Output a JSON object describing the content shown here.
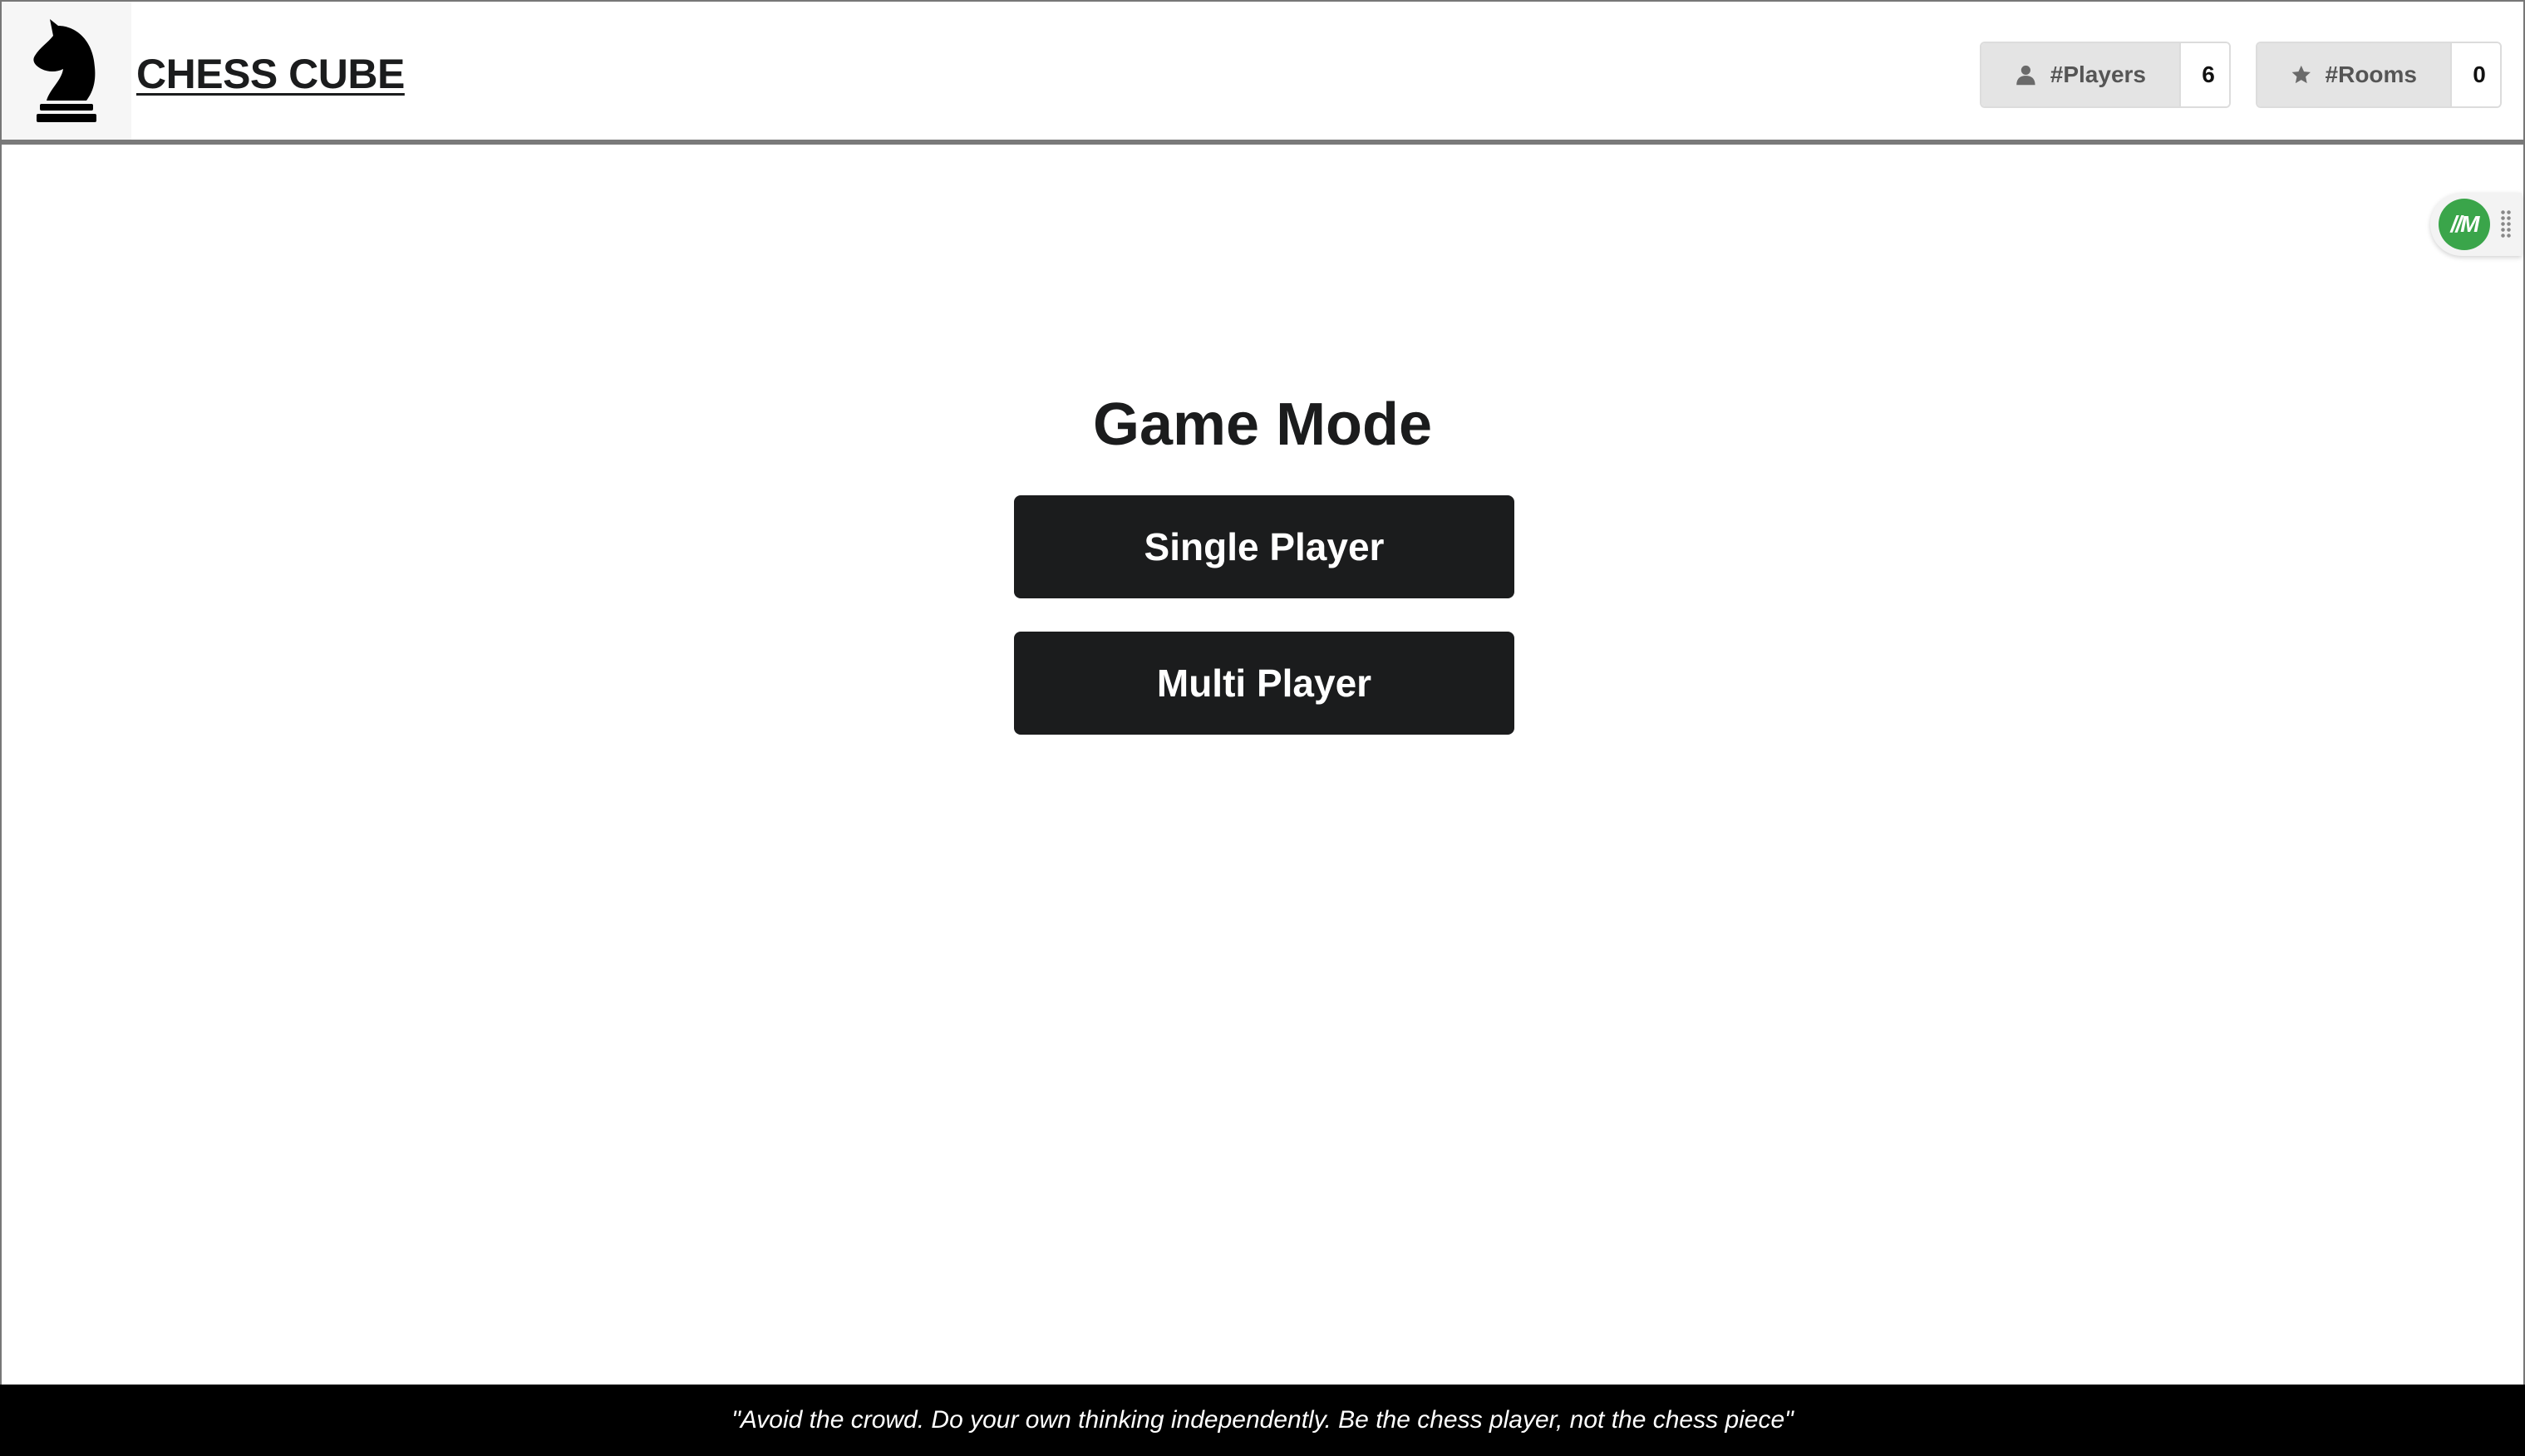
{
  "header": {
    "logo_icon": "chess-knight-icon",
    "brand": "CHESS CUBE",
    "stats": {
      "players_label": "#Players",
      "players_icon": "user-icon",
      "players_value": "6",
      "rooms_label": "#Rooms",
      "rooms_icon": "star-icon",
      "rooms_value": "0"
    }
  },
  "extension": {
    "badge_text": "//M",
    "badge_color": "#3aa54a"
  },
  "main": {
    "title": "Game Mode",
    "single_player": "Single Player",
    "multi_player": "Multi Player"
  },
  "footer": {
    "quote": "\"Avoid the crowd. Do your own thinking independently. Be the chess player, not the chess piece\""
  },
  "colors": {
    "button_bg": "#1b1c1d",
    "footer_bg": "#000000",
    "stat_label_bg": "#e4e4e4"
  }
}
